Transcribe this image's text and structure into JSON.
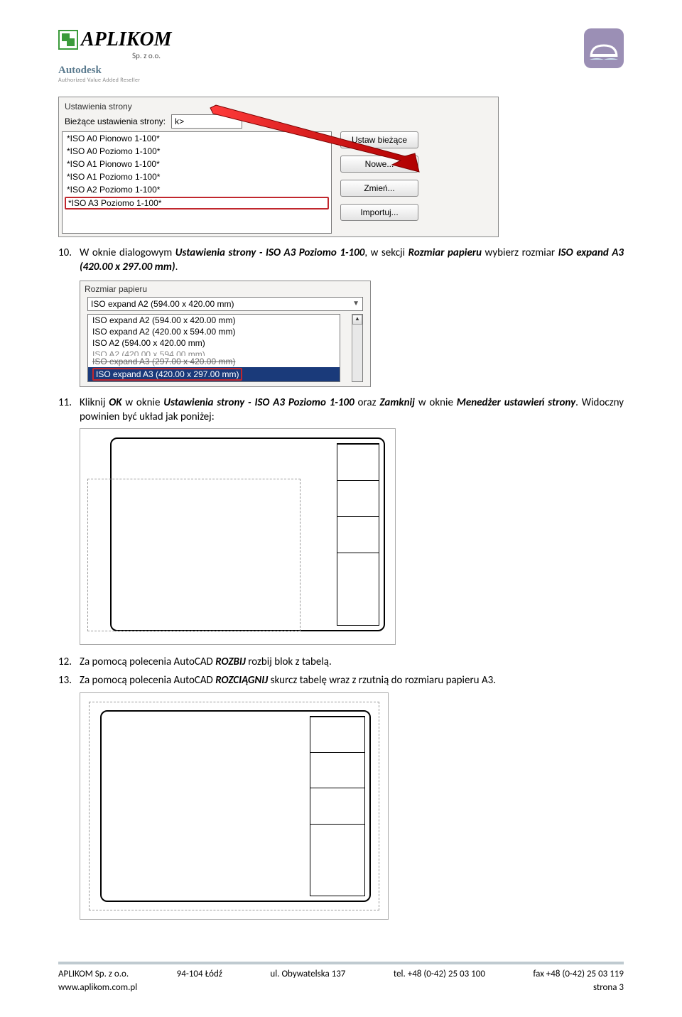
{
  "header": {
    "company": "APLIKOM",
    "suffix": "Sp. z o.o.",
    "autodesk": "Autodesk",
    "autodesk_sub": "Authorized Value Added Reseller"
  },
  "dlg1": {
    "group_title": "Ustawienia strony",
    "row_label": "Bieżące ustawienia strony:",
    "combo_value": "k>",
    "list": [
      "*ISO A0 Pionowo 1-100*",
      "*ISO A0 Poziomo 1-100*",
      "*ISO A1 Pionowo 1-100*",
      "*ISO A1 Poziomo 1-100*",
      "*ISO A2 Poziomo 1-100*",
      "*ISO A3 Poziomo 1-100*"
    ],
    "btn_set": "Ustaw bieżące",
    "btn_new": "Nowe...",
    "btn_mod": "Zmień...",
    "btn_imp": "Importuj..."
  },
  "step10": {
    "num": "10.",
    "text_a": "W oknie dialogowym ",
    "text_b": "Ustawienia strony - ISO A3 Poziomo 1-100",
    "text_c": ", w sekcji ",
    "text_d": "Rozmiar papieru",
    "text_e": " wybierz rozmiar ",
    "text_f": "ISO expand A3 (420.00 x 297.00 mm)",
    "text_g": "."
  },
  "dlg2": {
    "group_title": "Rozmiar papieru",
    "combo_value": "ISO expand A2 (594.00 x 420.00 mm)",
    "options": [
      "ISO expand A2 (594.00 x 420.00 mm)",
      "ISO expand A2 (420.00 x 594.00 mm)",
      "ISO A2 (594.00 x 420.00 mm)",
      "ISO A2 (420.00 x 594.00 mm)",
      "ISO expand A3 (297.00 x 420.00 mm)",
      "ISO expand A3 (420.00 x 297.00 mm)"
    ]
  },
  "step11": {
    "num": "11.",
    "text_a": "Kliknij ",
    "text_b": "OK",
    "text_c": " w oknie ",
    "text_d": "Ustawienia strony - ISO A3 Poziomo 1-100",
    "text_e": " oraz ",
    "text_f": "Zamknij",
    "text_g": " w oknie ",
    "text_h": "Menedżer ustawień strony",
    "text_i": ". Widoczny powinien być układ jak poniżej:"
  },
  "step12": {
    "num": "12.",
    "text_a": "Za pomocą polecenia AutoCAD ",
    "text_b": "ROZBIJ",
    "text_c": " rozbij blok z tabelą."
  },
  "step13": {
    "num": "13.",
    "text_a": "Za pomocą polecenia AutoCAD ",
    "text_b": "ROZCIĄGNIJ",
    "text_c": " skurcz tabelę wraz z rzutnią do rozmiaru papieru A3."
  },
  "footer": {
    "c1": "APLIKOM Sp. z o.o.",
    "c2": "94-104 Łódź",
    "c3": "ul. Obywatelska 137",
    "c4": "tel. +48 (0-42) 25 03 100",
    "c5": "fax  +48 (0-42) 25 03 119",
    "site": "www.aplikom.com.pl",
    "page": "strona 3"
  }
}
